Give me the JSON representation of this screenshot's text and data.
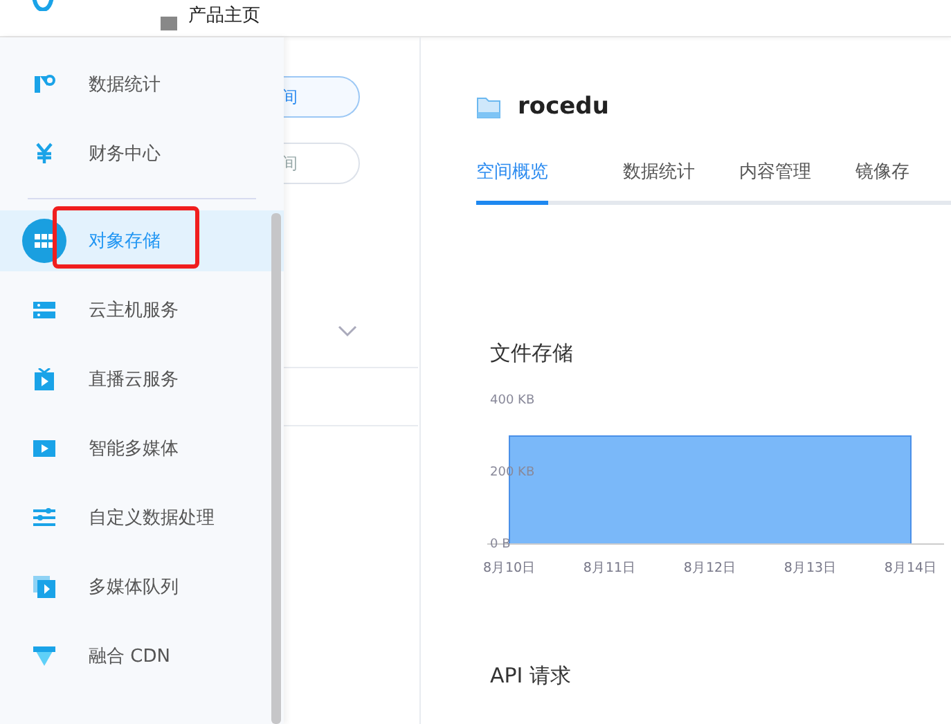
{
  "header": {
    "breadcrumb": "产品主页"
  },
  "background_panel": {
    "pills": [
      {
        "label": "间",
        "selected": true
      },
      {
        "label": "间",
        "selected": false
      }
    ]
  },
  "sidebar": {
    "groups": [
      {
        "items": [
          {
            "label": "数据统计",
            "selected": false,
            "highlighted": false
          },
          {
            "label": "财务中心",
            "selected": false,
            "highlighted": false
          }
        ]
      },
      {
        "items": [
          {
            "label": "对象存储",
            "selected": true,
            "highlighted": true
          },
          {
            "label": "云主机服务",
            "selected": false,
            "highlighted": false
          },
          {
            "label": "直播云服务",
            "selected": false,
            "highlighted": false
          },
          {
            "label": "智能多媒体",
            "selected": false,
            "highlighted": false
          },
          {
            "label": "自定义数据处理",
            "selected": false,
            "highlighted": false
          },
          {
            "label": "多媒体队列",
            "selected": false,
            "highlighted": false
          },
          {
            "label": "融合 CDN",
            "selected": false,
            "highlighted": false
          }
        ]
      }
    ]
  },
  "bucket": {
    "name": "rocedu"
  },
  "tabs": [
    {
      "label": "空间概览",
      "selected": true
    },
    {
      "label": "数据统计",
      "selected": false
    },
    {
      "label": "内容管理",
      "selected": false
    },
    {
      "label": "镜像存",
      "selected": false
    }
  ],
  "file_storage": {
    "title": "文件存储",
    "chart_data": {
      "type": "area",
      "categories": [
        "8月10日",
        "8月11日",
        "8月12日",
        "8月13日",
        "8月14日"
      ],
      "series": [
        {
          "color": "#7ab8f9",
          "values": [
            300,
            300,
            300,
            300,
            300
          ]
        }
      ],
      "ylim": [
        0,
        400
      ],
      "yticks": [
        {
          "value": 0,
          "label": "0 B"
        },
        {
          "value": 200,
          "label": "200 KB"
        },
        {
          "value": 400,
          "label": "400 KB"
        }
      ]
    }
  },
  "api_requests": {
    "title": "API 请求"
  }
}
